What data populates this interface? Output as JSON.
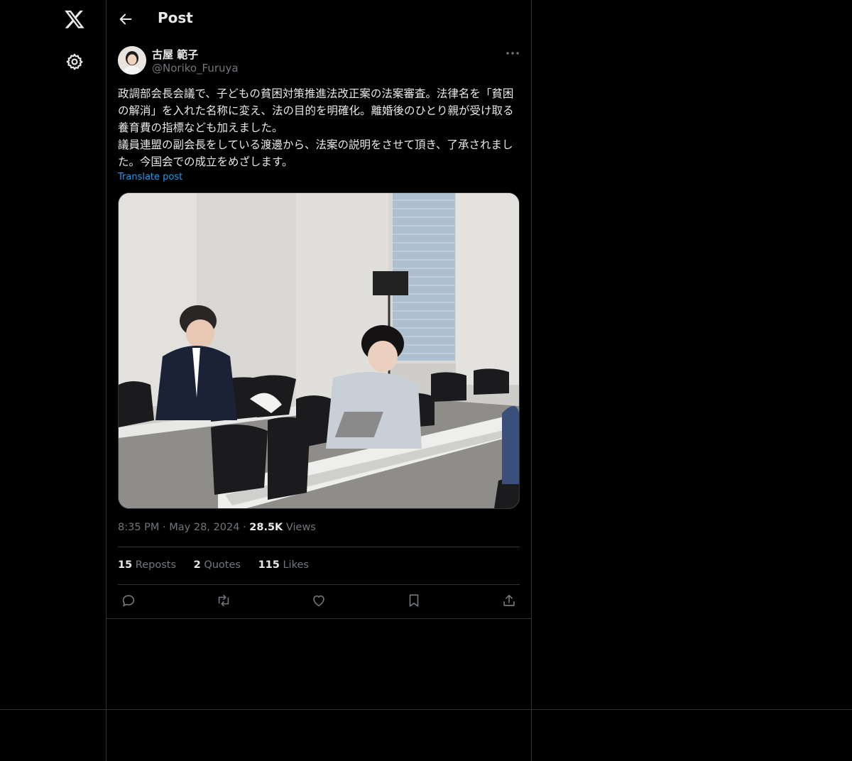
{
  "header": {
    "title": "Post"
  },
  "author": {
    "display_name": "古屋 範子",
    "handle": "@Noriko_Furuya"
  },
  "post": {
    "text": "政調部会長会議で、子どもの貧困対策推進法改正案の法案審査。法律名を「貧困の解消」を入れた名称に変え、法の目的を明確化。離婚後のひとり親が受け取る養育費の指標なども加えました。\n議員連盟の副会長をしている渡邊から、法案の説明をさせて頂き、了承されました。今国会での成立をめざします。",
    "translate_label": "Translate post",
    "time": "8:35 PM",
    "date": "May 28, 2024",
    "views_count": "28.5K",
    "views_label": "Views"
  },
  "stats": {
    "reposts_count": "15",
    "reposts_label": "Reposts",
    "quotes_count": "2",
    "quotes_label": "Quotes",
    "likes_count": "115",
    "likes_label": "Likes"
  },
  "icons": {
    "logo": "x-logo-icon",
    "settings": "gear-icon",
    "back": "back-arrow-icon",
    "more": "more-icon",
    "reply": "reply-icon",
    "repost": "repost-icon",
    "like": "heart-icon",
    "bookmark": "bookmark-icon",
    "share": "share-icon"
  },
  "colors": {
    "background": "#000000",
    "text": "#e7e9ea",
    "muted": "#71767b",
    "link": "#1d9bf0",
    "border": "#2f3336"
  }
}
